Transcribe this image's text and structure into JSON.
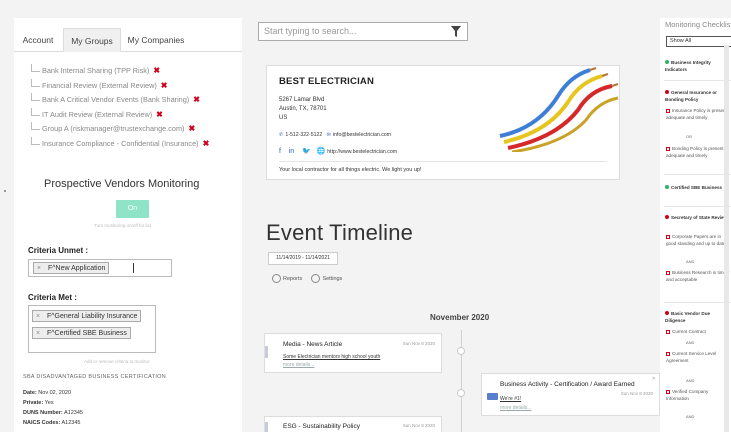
{
  "tabs": [
    "Account",
    "My Groups",
    "My Companies"
  ],
  "groups": [
    "Bank Internal Sharing (TPP Risk)",
    "Financial Review (External Review)",
    "Bank A Critical Vendor Events (Bank Sharing)",
    "IT Audit Review (External Review)",
    "Group A (riskmanager@trustexchange.com)",
    "Insurance Compliance - Confidential (Insurance)"
  ],
  "remove_glyph": "✖",
  "prospective": {
    "title": "Prospective Vendors Monitoring",
    "toggle_label": "On",
    "toggle_hint": "Turn monitoring on/off for list",
    "toggle_color": "#8fe3c7"
  },
  "criteria": {
    "unmet_label": "Criteria Unmet :",
    "unmet_items": [
      "F^New Application"
    ],
    "met_label": "Criteria Met :",
    "met_items": [
      "F^General Liability Insurance",
      "F^Certified SBE Business"
    ],
    "hint": "Add or remove criteria to monitor",
    "chip_remove": "×"
  },
  "certification": {
    "title": "SBA DISADVANTAGED BUSINESS CERTIFICATION",
    "lines": [
      {
        "label": "Date:",
        "value": "Nov 02, 2020"
      },
      {
        "label": "Private:",
        "value": "Yes"
      },
      {
        "label": "DUNS Number:",
        "value": "A12345"
      },
      {
        "label": "NAICS Codes:",
        "value": "A12345"
      }
    ]
  },
  "search": {
    "placeholder": "Start typing to search..."
  },
  "vendor": {
    "name": "BEST ELECTRICIAN",
    "address": [
      "5267 Lamar Blvd",
      "Austin, TX, 78701",
      "US"
    ],
    "phone": "1-512-322-5122",
    "email": "info@bestelectrician.com",
    "website": "http://www.bestelectrician.com",
    "tagline": "Your local contractor for all things electric. We light you up!",
    "accent": "#2f5fc7"
  },
  "timeline": {
    "title": "Event Timeline",
    "date_range": "11/14/2019 - 11/14/2021",
    "actions": [
      "Reports",
      "Settings"
    ],
    "month": "November 2020",
    "events": [
      {
        "title": "Media - News Article",
        "date": "Sun Nov 8 2020",
        "link": "Some Electrician mentors high school youth",
        "more": "more details..."
      },
      {
        "title": "Business Activity - Certification / Award Earned",
        "date": "Sun Nov 8 2020",
        "link": "We're #1!",
        "more": "more details..."
      },
      {
        "title": "ESG - Sustainability Policy",
        "date": "Sun Nov 8 2020",
        "link": "",
        "more": ""
      }
    ]
  },
  "monitoring": {
    "title": "Monitoring Checklist",
    "filter_value": "Show All",
    "and_label": "AND",
    "or_label": "OR",
    "items": [
      {
        "label": "Business Integrity Indicators",
        "status": "green"
      },
      {
        "label": "General Insurance or Bonding Policy",
        "status": "red",
        "subs": [
          "Insurance Policy is present, adequate and timely",
          "Bonding Policy is present, adequate and timely"
        ]
      },
      {
        "label": "Certified SBE Business",
        "status": "green"
      },
      {
        "label": "Secretary of State Review",
        "status": "red",
        "subs": [
          "Corporate Papers are in good standing and up to date",
          "Business Research is timely and acceptable"
        ]
      },
      {
        "label": "Basic Vendor Due Diligence",
        "status": "red",
        "subs": [
          "Current Contract",
          "Current Service Level Agreement",
          "Verified Company Information"
        ]
      }
    ],
    "green": "#2db36a",
    "red": "#d0021b"
  }
}
